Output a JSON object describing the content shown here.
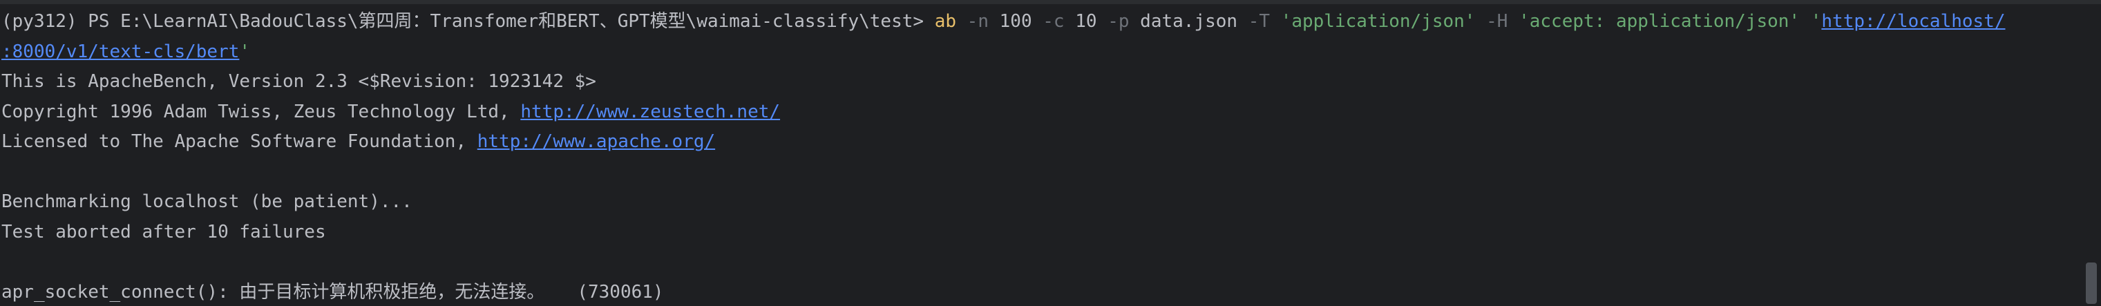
{
  "terminal": {
    "prompt": "(py312) PS E:\\LearnAI\\BadouClass\\第四周：Transfomer和BERT、GPT模型\\waimai-classify\\test> ",
    "command": {
      "program": "ab",
      "flag_n": "-n",
      "value_n": "100",
      "flag_c": "-c",
      "value_c": "10",
      "flag_p": "-p",
      "value_p": "data.json",
      "flag_T": "-T",
      "value_T": "'application/json'",
      "flag_H": "-H",
      "value_H": "'accept: application/json'",
      "url_quote_open": "'",
      "url_part1": "http://localhost/",
      "url_part2": ":8000/v1/text-cls/bert",
      "url_quote_close": "'"
    },
    "output": {
      "line1": "This is ApacheBench, Version 2.3 <$Revision: 1923142 $>",
      "line2_text": "Copyright 1996 Adam Twiss, Zeus Technology Ltd, ",
      "line2_link": "http://www.zeustech.net/",
      "line3_text": "Licensed to The Apache Software Foundation, ",
      "line3_link": "http://www.apache.org/",
      "line4": "",
      "line5": "Benchmarking localhost (be patient)...",
      "line6": "Test aborted after 10 failures",
      "line7": "",
      "line8": "apr_socket_connect(): 由于目标计算机积极拒绝，无法连接。   (730061)"
    }
  }
}
